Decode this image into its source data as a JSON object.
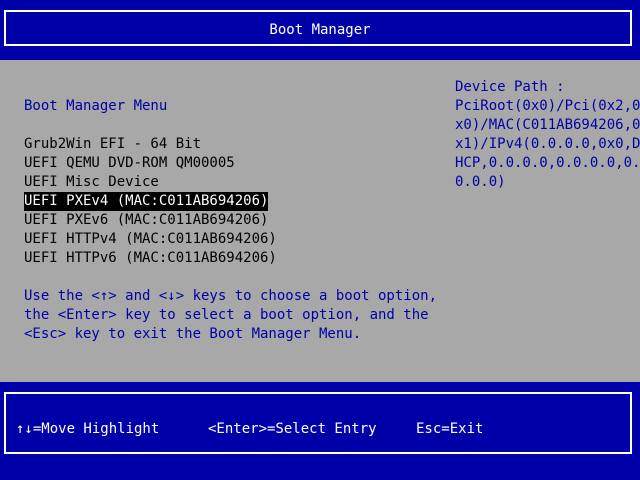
{
  "title": "Boot Manager",
  "menu_heading": "Boot Manager Menu",
  "boot_options": [
    {
      "label": "Grub2Win EFI - 64 Bit",
      "selected": false
    },
    {
      "label": "UEFI QEMU DVD-ROM QM00005",
      "selected": false
    },
    {
      "label": "UEFI Misc Device",
      "selected": false
    },
    {
      "label": "UEFI PXEv4 (MAC:C011AB694206)",
      "selected": true
    },
    {
      "label": "UEFI PXEv6 (MAC:C011AB694206)",
      "selected": false
    },
    {
      "label": "UEFI HTTPv4 (MAC:C011AB694206)",
      "selected": false
    },
    {
      "label": "UEFI HTTPv6 (MAC:C011AB694206)",
      "selected": false
    }
  ],
  "help_text": [
    "Use the <↑> and <↓> keys to choose a boot option,",
    "the <Enter> key to select a boot option, and the",
    "<Esc> key to exit the Boot Manager Menu."
  ],
  "device_path": {
    "label": "Device Path :",
    "lines": [
      "PciRoot(0x0)/Pci(0x2,0",
      "x0)/MAC(C011AB694206,0",
      "x1)/IPv4(0.0.0.0,0x0,D",
      "HCP,0.0.0.0,0.0.0.0,0.",
      "0.0.0)"
    ]
  },
  "footer": {
    "move": "↑↓=Move Highlight",
    "select": "<Enter>=Select Entry",
    "exit": "Esc=Exit"
  },
  "colors": {
    "frame_background": "#0000a8",
    "body_background": "#a8a8a8",
    "accent_text": "#0000a8",
    "highlight_background": "#000000",
    "highlight_text": "#ffffff"
  }
}
